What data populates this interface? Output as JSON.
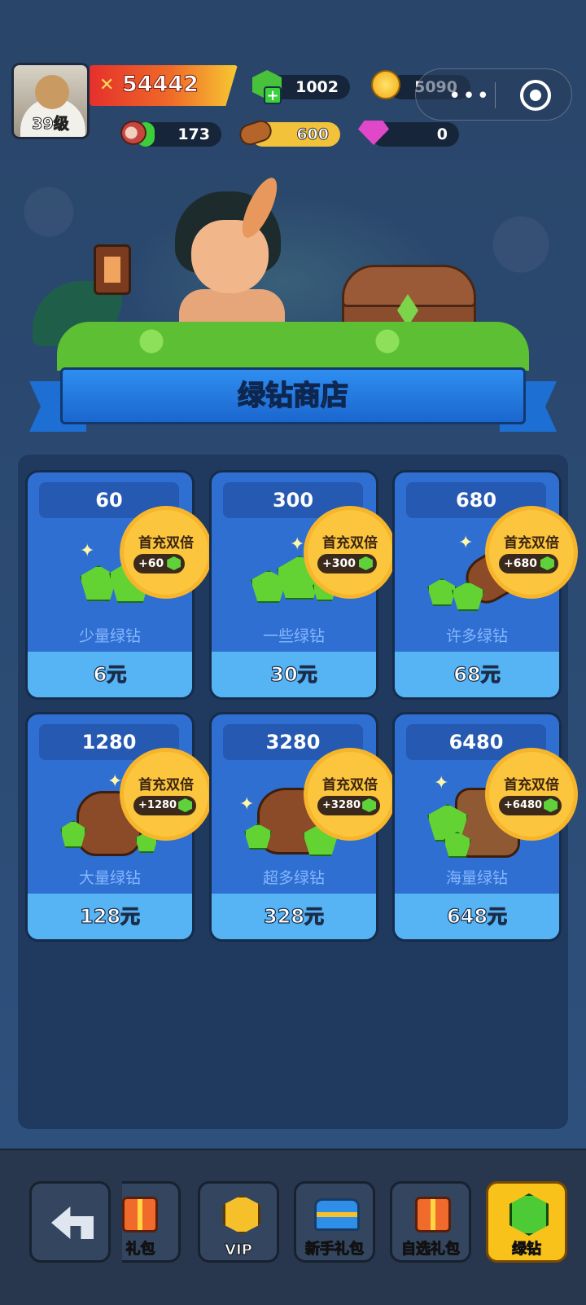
{
  "player": {
    "level": "39级",
    "power": "54442"
  },
  "resources": {
    "green_diamonds": "1002",
    "coins": "5090",
    "meat": "173",
    "wood": "600",
    "pink_diamonds": "0"
  },
  "capsule": {
    "more": "•••"
  },
  "shop": {
    "title": "绿钻商店",
    "bonus_title": "首充双倍",
    "items": [
      {
        "amount": "60",
        "bonus": "+60",
        "name": "少量绿钻",
        "price": "6元"
      },
      {
        "amount": "300",
        "bonus": "+300",
        "name": "一些绿钻",
        "price": "30元"
      },
      {
        "amount": "680",
        "bonus": "+680",
        "name": "许多绿钻",
        "price": "68元"
      },
      {
        "amount": "1280",
        "bonus": "+1280",
        "name": "大量绿钻",
        "price": "128元"
      },
      {
        "amount": "3280",
        "bonus": "+3280",
        "name": "超多绿钻",
        "price": "328元"
      },
      {
        "amount": "6480",
        "bonus": "+6480",
        "name": "海量绿钻",
        "price": "648元"
      }
    ]
  },
  "bottom_nav": [
    {
      "label": "",
      "icon": "back-arrow-icon"
    },
    {
      "label": "礼包",
      "icon": "gift-icon"
    },
    {
      "label": "VIP",
      "icon": "vip-icon"
    },
    {
      "label": "新手礼包",
      "icon": "chest-icon"
    },
    {
      "label": "自选礼包",
      "icon": "gift-icon"
    },
    {
      "label": "绿钻",
      "icon": "green-diamond-icon",
      "active": true
    }
  ],
  "colors": {
    "background": "#2c4a72",
    "card": "#2f6fd1",
    "price_bar": "#56b4f5",
    "badge": "#fbc53d",
    "active_nav": "#f8c21a"
  }
}
